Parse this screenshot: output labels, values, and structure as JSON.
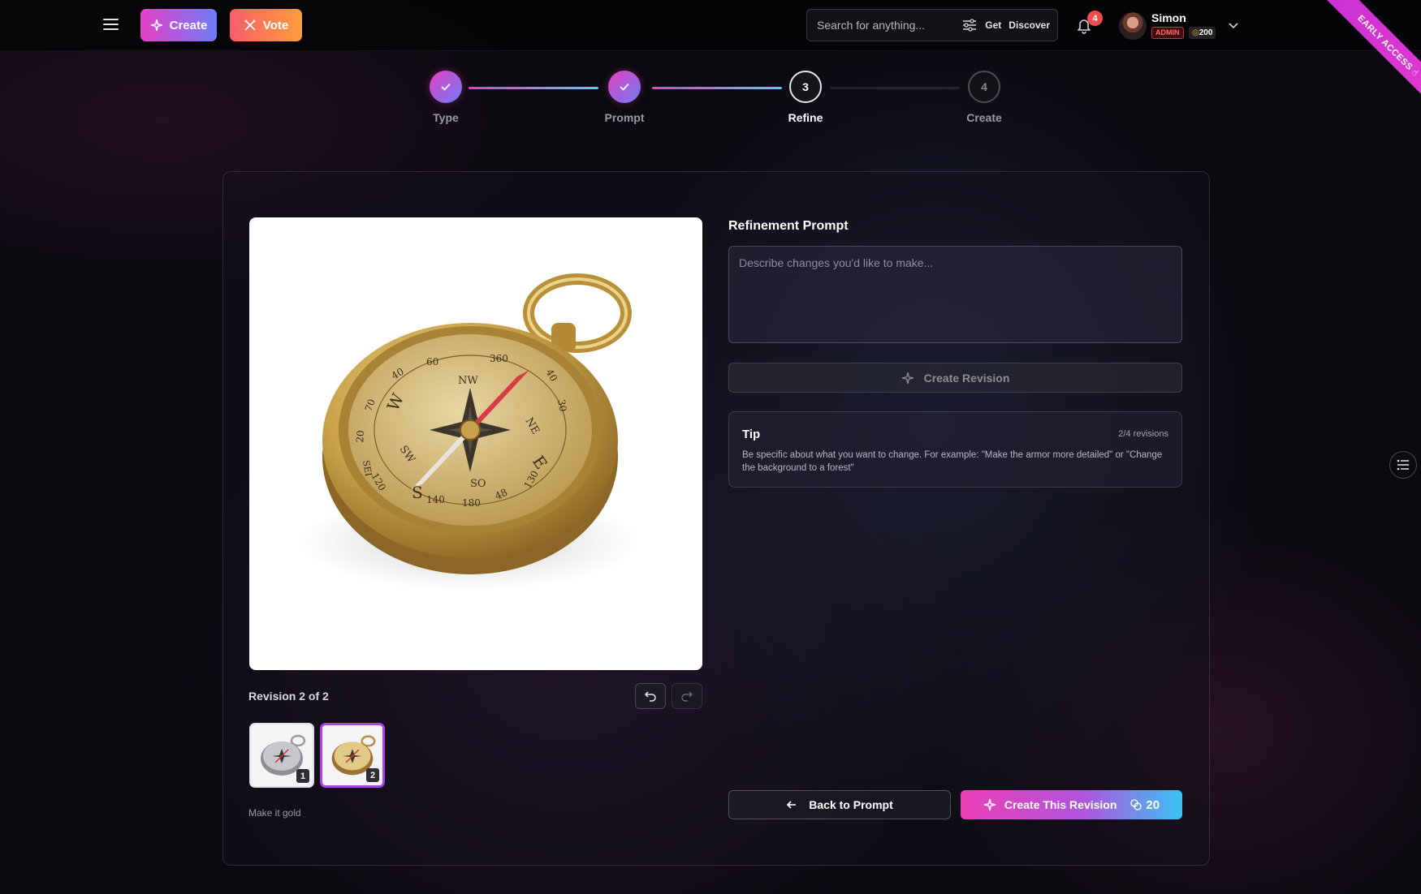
{
  "header": {
    "create_label": "Create",
    "vote_label": "Vote",
    "search_placeholder": "Search for anything...",
    "get_label": "Get",
    "discover_label": "Discover",
    "notification_count": "4",
    "user": {
      "name": "Simon",
      "role": "ADMIN",
      "credits_icon": "◎",
      "credits": "200"
    },
    "ribbon": "EARLY ACCESS ☝"
  },
  "stepper": {
    "steps": [
      {
        "label": "Type",
        "number": "",
        "state": "done"
      },
      {
        "label": "Prompt",
        "number": "",
        "state": "done"
      },
      {
        "label": "Refine",
        "number": "3",
        "state": "current"
      },
      {
        "label": "Create",
        "number": "4",
        "state": "upcoming"
      }
    ]
  },
  "preview": {
    "revision_label": "Revision 2 of 2",
    "thumbnails": [
      {
        "number": "1",
        "variant": "silver compass",
        "selected": false
      },
      {
        "number": "2",
        "variant": "gold compass",
        "selected": true
      }
    ],
    "caption": "Make it gold",
    "compass_marks": {
      "cardinal": [
        "NW",
        "NE",
        "SW",
        "SO",
        "W",
        "E",
        "S"
      ],
      "degrees": [
        "60",
        "360",
        "40",
        "70",
        "20",
        "120",
        "140",
        "180",
        "48",
        "30",
        "130",
        "40",
        "SEI"
      ]
    }
  },
  "refine": {
    "title": "Refinement Prompt",
    "placeholder": "Describe changes you'd like to make...",
    "create_revision_label": "Create Revision",
    "tip": {
      "title": "Tip",
      "count": "2/4 revisions",
      "text": "Be specific about what you want to change. For example: \"Make the armor more detailed\" or \"Change the background to a forest\""
    },
    "back_label": "Back to Prompt",
    "submit_label": "Create This Revision",
    "submit_cost": "20"
  },
  "colors": {
    "accent_pink": "#ec3fb6",
    "accent_blue": "#39c2f2",
    "selected_thumb": "#a845e8",
    "gold": "#c9a24a"
  },
  "icons": [
    "menu-icon",
    "sparkle-icon",
    "vote-icon",
    "filter-icon",
    "bell-icon",
    "chevron-down-icon",
    "check-icon",
    "undo-icon",
    "redo-icon",
    "arrow-left-icon",
    "coins-icon",
    "side-panel-icon"
  ]
}
